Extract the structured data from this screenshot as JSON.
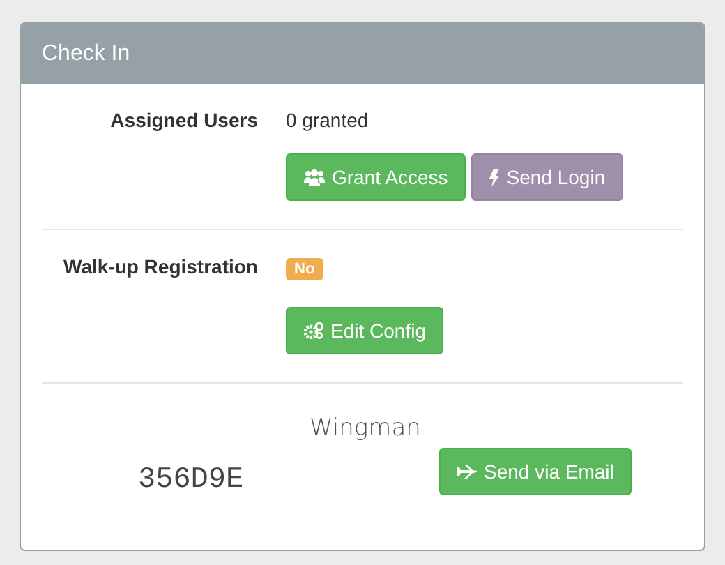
{
  "panel": {
    "title": "Check In"
  },
  "assigned_users": {
    "label": "Assigned Users",
    "value": "0 granted",
    "buttons": [
      {
        "label": "Grant Access",
        "kind": "access"
      },
      {
        "label": "Send Login",
        "kind": "login"
      }
    ]
  },
  "walkup": {
    "label": "Walk-up Registration",
    "badge": {
      "text": "No",
      "color": "#f0ad4e"
    },
    "buttons": [
      {
        "label": "Edit Config",
        "kind": "config"
      }
    ]
  },
  "wingman": {
    "title": "Wingman",
    "code": "356D9E",
    "buttons": [
      {
        "label": "Send via Email",
        "kind": "email"
      }
    ]
  }
}
